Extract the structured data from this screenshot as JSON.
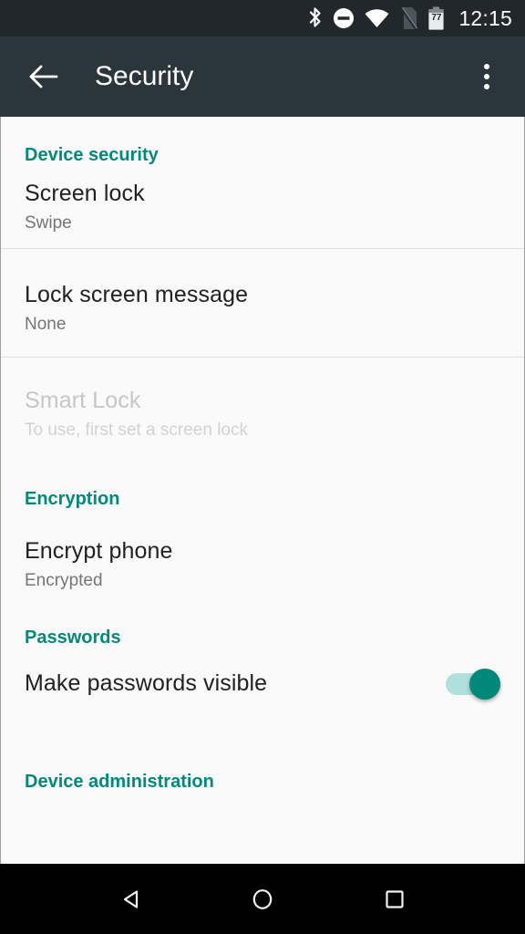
{
  "status_bar": {
    "time": "12:15",
    "battery_percent": "77",
    "icons": [
      {
        "name": "bluetooth-icon",
        "label": "Bluetooth"
      },
      {
        "name": "do-not-disturb-icon",
        "label": "Do not disturb"
      },
      {
        "name": "wifi-icon",
        "label": "Wi-Fi"
      },
      {
        "name": "no-sim-icon",
        "label": "No SIM"
      },
      {
        "name": "battery-icon",
        "label": "Battery 77%"
      }
    ]
  },
  "app_bar": {
    "title": "Security",
    "back_icon": "back-arrow-icon",
    "overflow_icon": "overflow-menu-icon"
  },
  "colors": {
    "accent_teal": "#00897b",
    "app_bar": "#2b363c",
    "status_bar": "#21272b",
    "background": "#fafafa",
    "title_text": "#212121",
    "subtitle_text": "#757575",
    "disabled_text": "#c6c6c6",
    "divider": "#e0e0e0",
    "switch_track_on": "#b2dfdb",
    "switch_thumb_on": "#00897b",
    "nav_bar": "#000000"
  },
  "sections": [
    {
      "header": "Device security",
      "items": [
        {
          "title": "Screen lock",
          "subtitle": "Swipe",
          "disabled": false,
          "has_switch": false
        },
        {
          "title": "Lock screen message",
          "subtitle": "None",
          "disabled": false,
          "has_switch": false
        },
        {
          "title": "Smart Lock",
          "subtitle": "To use, first set a screen lock",
          "disabled": true,
          "has_switch": false
        }
      ]
    },
    {
      "header": "Encryption",
      "items": [
        {
          "title": "Encrypt phone",
          "subtitle": "Encrypted",
          "disabled": false,
          "has_switch": false
        }
      ]
    },
    {
      "header": "Passwords",
      "items": [
        {
          "title": "Make passwords visible",
          "subtitle": "",
          "disabled": false,
          "has_switch": true,
          "switch_on": true
        }
      ]
    },
    {
      "header": "Device administration",
      "items": []
    }
  ],
  "nav_bar": {
    "back_label": "Back",
    "home_label": "Home",
    "recents_label": "Recents"
  }
}
